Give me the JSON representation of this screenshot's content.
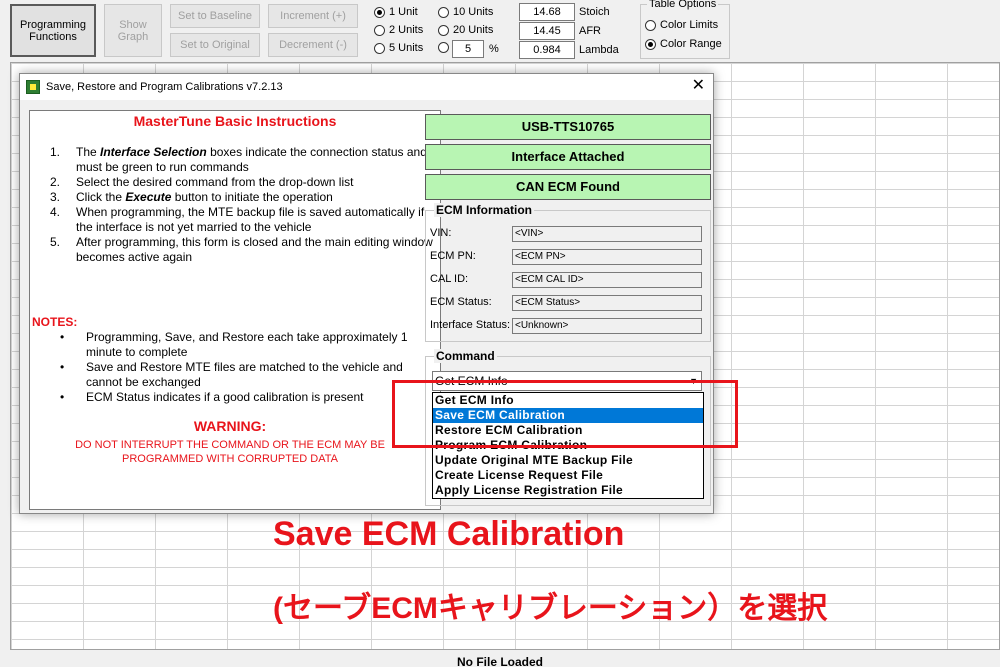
{
  "toolbar": {
    "programming_functions": "Programming\nFunctions",
    "show_graph": "Show\nGraph",
    "set_to_baseline": "Set to Baseline",
    "set_to_original": "Set to Original",
    "increment": "Increment (+)",
    "decrement": "Decrement (-)",
    "units": [
      "1 Unit",
      "2 Units",
      "5 Units",
      "10 Units",
      "20 Units"
    ],
    "custom_units": "5",
    "percent": "%",
    "stoich_value": "14.68",
    "stoich_label": "Stoich",
    "afr_value": "14.45",
    "afr_label": "AFR",
    "lambda_value": "0.984",
    "lambda_label": "Lambda",
    "table_options_title": "Table Options",
    "color_limits": "Color Limits",
    "color_range": "Color Range"
  },
  "status_bar": "No File Loaded",
  "dialog": {
    "title": "Save, Restore and Program Calibrations  v7.2.13",
    "close": "✕",
    "instructions": {
      "title": "MasterTune Basic Instructions",
      "steps": [
        {
          "n": "1.",
          "pre": "The ",
          "em": "Interface Selection",
          "post": " boxes indicate the connection status and must be green to run commands"
        },
        {
          "n": "2.",
          "pre": "Select the desired command from the drop-down list",
          "em": "",
          "post": ""
        },
        {
          "n": "3.",
          "pre": "Click the ",
          "em": "Execute",
          "post": " button to initiate the operation"
        },
        {
          "n": "4.",
          "pre": "When programming, the MTE backup file is saved automatically if the interface is not yet married to the vehicle",
          "em": "",
          "post": ""
        },
        {
          "n": "5.",
          "pre": "After programming, this form is closed and the main editing window becomes active again",
          "em": "",
          "post": ""
        }
      ],
      "notes_heading": "NOTES:",
      "notes": [
        "Programming, Save, and Restore each take approximately 1 minute to complete",
        "Save and Restore MTE files are matched to the vehicle and cannot be exchanged",
        "ECM Status indicates if a good calibration is present"
      ],
      "warning_heading": "WARNING:",
      "warning_text": "DO NOT INTERRUPT THE COMMAND OR THE ECM MAY BE PROGRAMMED WITH CORRUPTED DATA"
    },
    "interface": {
      "usb": "USB-TTS10765",
      "attached": "Interface Attached",
      "can": "CAN ECM Found",
      "status_color": "#b8f5b3"
    },
    "ecm_info": {
      "title": "ECM Information",
      "rows": [
        {
          "label": "VIN:",
          "value": "<VIN>"
        },
        {
          "label": "ECM PN:",
          "value": "<ECM PN>"
        },
        {
          "label": "CAL ID:",
          "value": "<ECM CAL ID>"
        },
        {
          "label": "ECM Status:",
          "value": "<ECM Status>"
        },
        {
          "label": "Interface Status:",
          "value": "<Unknown>"
        }
      ]
    },
    "command": {
      "title": "Command",
      "selected": "Get ECM Info",
      "options": [
        "Get ECM Info",
        "Save ECM Calibration",
        "Restore ECM Calibration",
        "Program ECM Calibration",
        "Update Original MTE Backup File",
        "Create License Request File",
        "Apply License Registration File"
      ],
      "highlighted": "Save ECM Calibration"
    }
  },
  "caption": {
    "line1": "Save ECM Calibration",
    "line2": "(セーブECMキャリブレーション）を選択",
    "color": "#e8141b"
  }
}
